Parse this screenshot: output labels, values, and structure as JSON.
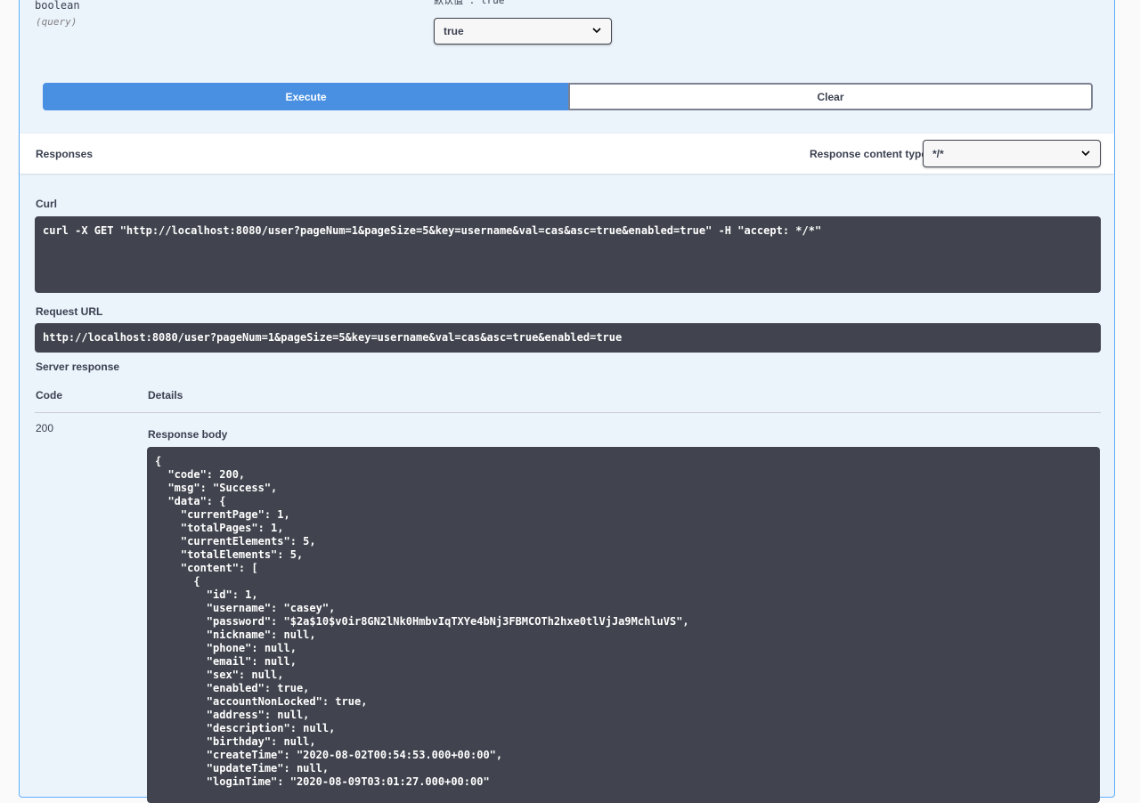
{
  "parameter": {
    "type": "boolean",
    "in": "(query)",
    "default_text": "默认值 : true",
    "selected": "true"
  },
  "actions": {
    "execute_label": "Execute",
    "clear_label": "Clear"
  },
  "responses": {
    "title": "Responses",
    "content_type_label": "Response content type",
    "content_type_value": "*/*"
  },
  "curl": {
    "label": "Curl",
    "command": "curl -X GET \"http://localhost:8080/user?pageNum=1&pageSize=5&key=username&val=cas&asc=true&enabled=true\" -H \"accept: */*\""
  },
  "request_url": {
    "label": "Request URL",
    "value": "http://localhost:8080/user?pageNum=1&pageSize=5&key=username&val=cas&asc=true&enabled=true"
  },
  "server_response": {
    "label": "Server response",
    "code_header": "Code",
    "details_header": "Details",
    "code": "200",
    "body_label": "Response body",
    "body": "{\n  \"code\": 200,\n  \"msg\": \"Success\",\n  \"data\": {\n    \"currentPage\": 1,\n    \"totalPages\": 1,\n    \"currentElements\": 5,\n    \"totalElements\": 5,\n    \"content\": [\n      {\n        \"id\": 1,\n        \"username\": \"casey\",\n        \"password\": \"$2a$10$v0ir8GN2lNk0HmbvIqTXYe4bNj3FBMCOTh2hxe0tlVjJa9MchluVS\",\n        \"nickname\": null,\n        \"phone\": null,\n        \"email\": null,\n        \"sex\": null,\n        \"enabled\": true,\n        \"accountNonLocked\": true,\n        \"address\": null,\n        \"description\": null,\n        \"birthday\": null,\n        \"createTime\": \"2020-08-02T00:54:53.000+00:00\",\n        \"updateTime\": null,\n        \"loginTime\": \"2020-08-09T03:01:27.000+00:00\""
  }
}
